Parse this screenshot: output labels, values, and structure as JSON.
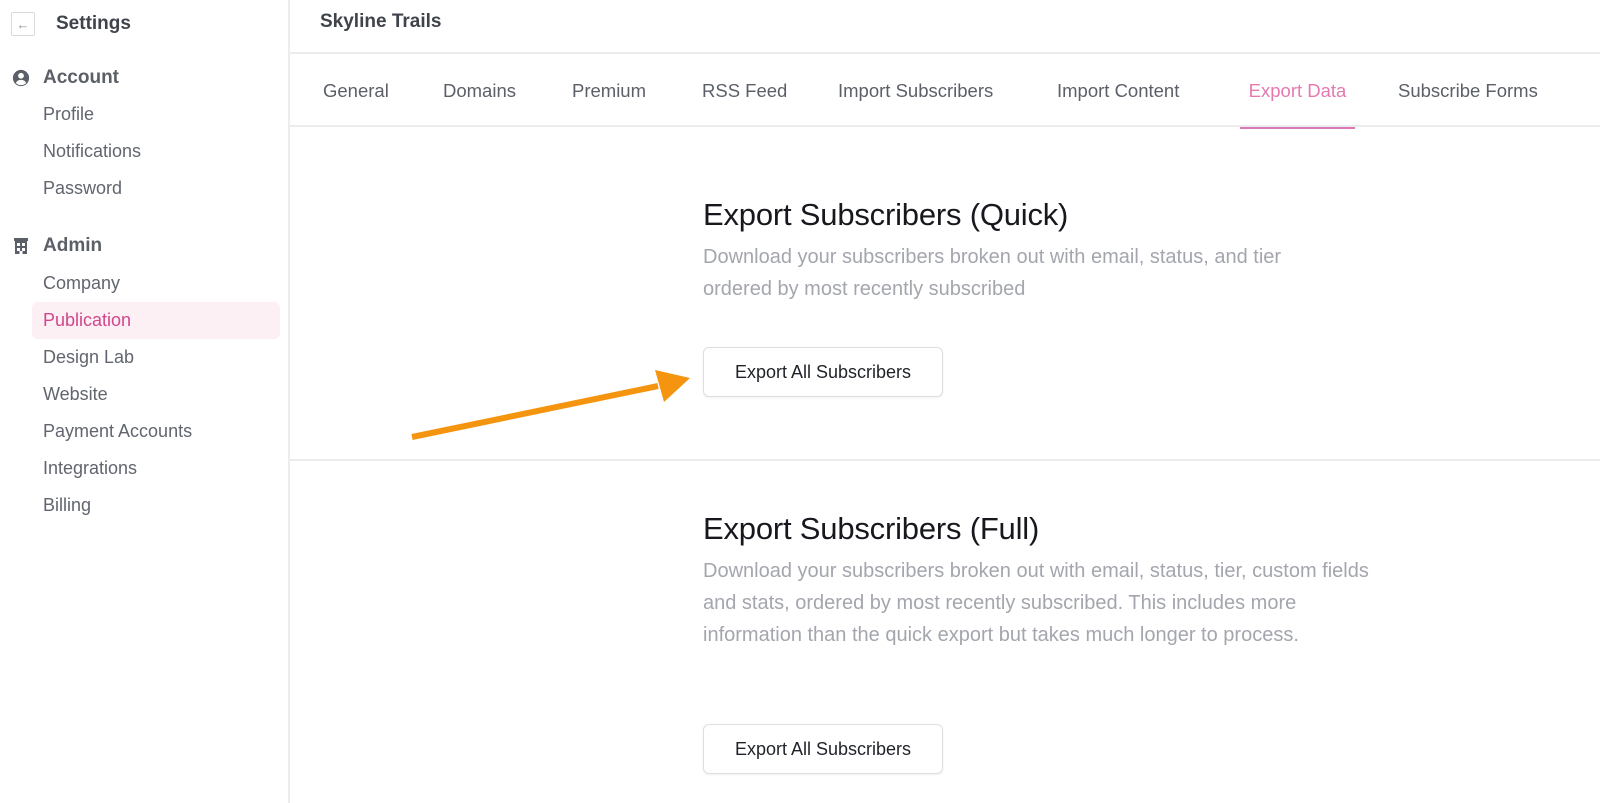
{
  "sidebar": {
    "title": "Settings",
    "back_icon": "arrow-left-icon",
    "sections": [
      {
        "label": "Account",
        "icon": "user-circle-icon",
        "items": [
          {
            "label": "Profile"
          },
          {
            "label": "Notifications"
          },
          {
            "label": "Password"
          }
        ]
      },
      {
        "label": "Admin",
        "icon": "building-icon",
        "items": [
          {
            "label": "Company"
          },
          {
            "label": "Publication",
            "active": true
          },
          {
            "label": "Design Lab"
          },
          {
            "label": "Website"
          },
          {
            "label": "Payment Accounts"
          },
          {
            "label": "Integrations"
          },
          {
            "label": "Billing"
          }
        ]
      }
    ]
  },
  "header": {
    "publication_name": "Skyline Trails"
  },
  "tabs": [
    {
      "label": "General"
    },
    {
      "label": "Domains"
    },
    {
      "label": "Premium"
    },
    {
      "label": "RSS Feed"
    },
    {
      "label": "Import Subscribers"
    },
    {
      "label": "Import Content"
    },
    {
      "label": "Export Data",
      "active": true
    },
    {
      "label": "Subscribe Forms"
    }
  ],
  "content": {
    "quick_export": {
      "heading": "Export Subscribers (Quick)",
      "description": "Download your subscribers broken out with email, status, and tier ordered by most recently subscribed",
      "button_label": "Export All Subscribers"
    },
    "full_export": {
      "heading": "Export Subscribers (Full)",
      "description": "Download your subscribers broken out with email, status, tier, custom fields and stats, ordered by most recently subscribed. This includes more information than the quick export but takes much longer to process.",
      "button_label": "Export All Subscribers"
    }
  },
  "annotation": {
    "icon": "arrow-annotation-icon",
    "color": "#f5950f"
  },
  "colors": {
    "accent": "#d1478b",
    "accent_tab": "#e57ab0",
    "active_item_bg": "#fdf0f5"
  }
}
